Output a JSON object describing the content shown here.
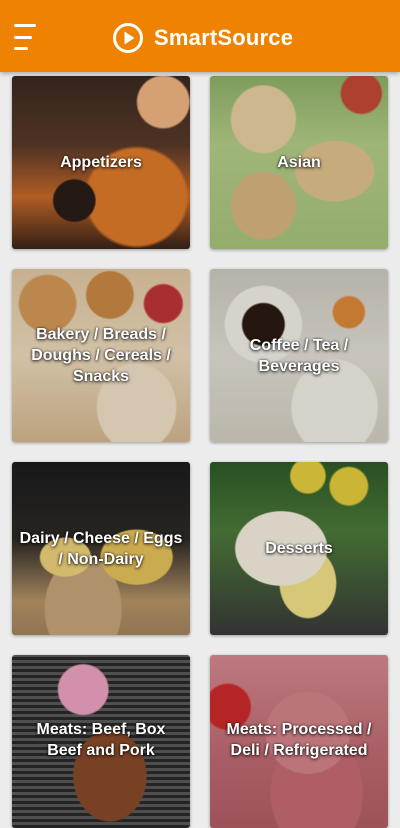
{
  "app_bar": {
    "title": "SmartSource",
    "menu_icon": "hamburger-menu-icon",
    "logo_icon": "play-circle-icon",
    "color": "#ef8200"
  },
  "categories": [
    {
      "label": "Appetizers"
    },
    {
      "label": "Asian"
    },
    {
      "label": "Bakery / Breads / Doughs / Cereals / Snacks"
    },
    {
      "label": "Coffee / Tea / Beverages"
    },
    {
      "label": "Dairy / Cheese / Eggs / Non-Dairy"
    },
    {
      "label": "Desserts"
    },
    {
      "label": "Meats: Beef, Box Beef and Pork"
    },
    {
      "label": "Meats: Processed / Deli / Refrigerated"
    }
  ]
}
